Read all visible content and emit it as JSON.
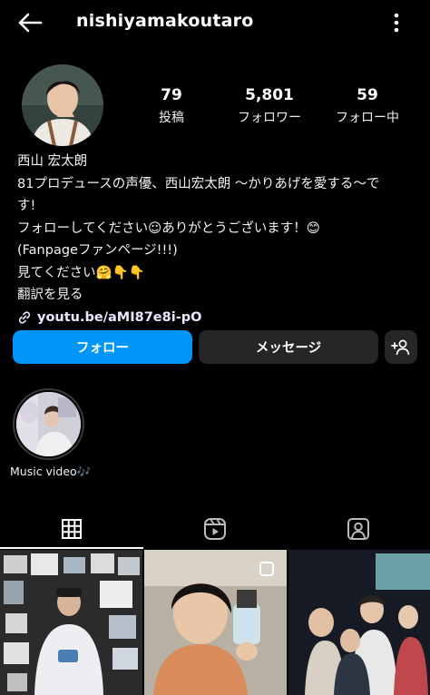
{
  "header": {
    "username": "nishiyamakoutaro"
  },
  "stats": [
    {
      "value": "79",
      "label": "投稿"
    },
    {
      "value": "5,801",
      "label": "フォロワー"
    },
    {
      "value": "59",
      "label": "フォロー中"
    }
  ],
  "bio": {
    "name": "西山 宏太朗",
    "line1": "81プロデュースの声優、西山宏太朗 〜かりあげを愛する〜で",
    "line2": "す!",
    "line3": "フォローしてください☺ありがとうございます！😊",
    "line4": "(Fanpageファンページ!!!)",
    "line5": "見てください🤗👇👇",
    "translate": "翻訳を見る",
    "link": "youtu.be/aMI87e8i-pO"
  },
  "actions": {
    "follow": "フォロー",
    "message": "メッセージ"
  },
  "highlights": [
    {
      "label": "Music video🎶"
    }
  ],
  "colors": {
    "follow_button": "#0095f6",
    "secondary_button": "#262626",
    "background": "#000000"
  }
}
